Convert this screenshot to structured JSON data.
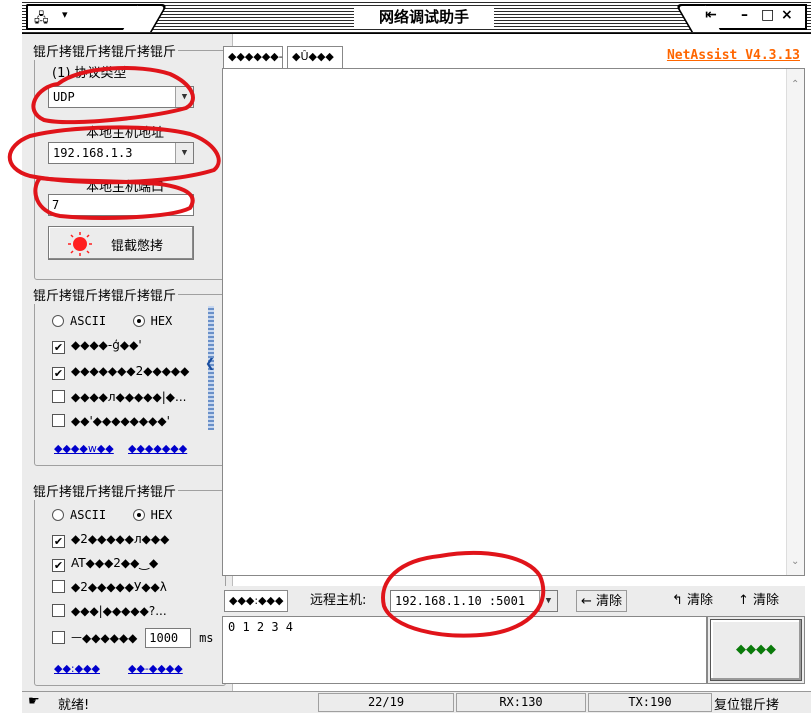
{
  "window": {
    "title": "网络调试助手",
    "menu_arrow": "▾",
    "pin_icon": "pin-icon",
    "minimize_label": "–",
    "maximize_label": "□",
    "close_label": "×"
  },
  "net_settings": {
    "group_title": "锟斤拷锟斤拷锟斤拷锟斤",
    "protocol_label": "(1) 协议类型",
    "protocol_value": "UDP",
    "host_label": "本地主机地址",
    "host_value": "192.168.1.3",
    "port_label": "本地主机端口",
    "port_value": "7",
    "connect_button_label": "锟截憋拷"
  },
  "recv_settings": {
    "group_title": "锟斤拷锟斤拷锟斤拷锟斤",
    "mode_ascii": "ASCII",
    "mode_hex": "HEX",
    "selected_mode": "HEX",
    "options": [
      {
        "label": "◆◆◆◆-ģ◆◆'",
        "checked": true
      },
      {
        "label": "◆◆◆◆◆◆◆2◆◆◆◆◆",
        "checked": true
      },
      {
        "label": "◆◆◆◆л◆◆◆◆◆|◆...",
        "checked": false
      },
      {
        "label": "◆◆'◆◆◆◆◆◆◆◆'",
        "checked": false
      }
    ],
    "link_left": "◆◆◆◆w◆◆",
    "link_right": "◆◆◆◆◆◆◆"
  },
  "send_settings": {
    "group_title": "锟斤拷锟斤拷锟斤拷锟斤",
    "mode_ascii": "ASCII",
    "mode_hex": "HEX",
    "options": [
      {
        "label": "◆2◆◆◆◆◆л◆◆◆",
        "checked": true
      },
      {
        "label": "AT◆◆◆2◆◆‿◆",
        "checked": true
      },
      {
        "label": "◆2◆◆◆◆◆У◆◆λ",
        "checked": false
      },
      {
        "label": "◆◆◆|◆◆◆◆◆?...",
        "checked": false
      },
      {
        "label": "ㅡ◆◆◆◆◆◆",
        "checked": false
      }
    ],
    "interval_value": "1000",
    "interval_unit": "ms",
    "link_left": "◆◆:◆◆◆",
    "link_right": "◆◆-◆◆◆◆"
  },
  "tabs": [
    {
      "label": "◆◆◆◆◆◆-"
    },
    {
      "label": "◆Û◆◆◆"
    }
  ],
  "version": "NetAssist V4.3.13",
  "send_bar": {
    "left_tab": "◆◆◆:◆◆◆",
    "remote_label": "远程主机:",
    "remote_value": "192.168.1.10 :5001",
    "clear1": "清除",
    "clear2": "清除",
    "clear3": "清除"
  },
  "send_text": "0 1 2 3 4",
  "send_button_label": "◆◆◆◆",
  "status": {
    "ready": "就绪!",
    "counter": "22/19",
    "rx": "RX:130",
    "tx": "TX:190",
    "right_text": "复位锟斤拷"
  },
  "colors": {
    "annotation": "#e0141a",
    "version": "#ff6600",
    "link": "#0000cc"
  }
}
